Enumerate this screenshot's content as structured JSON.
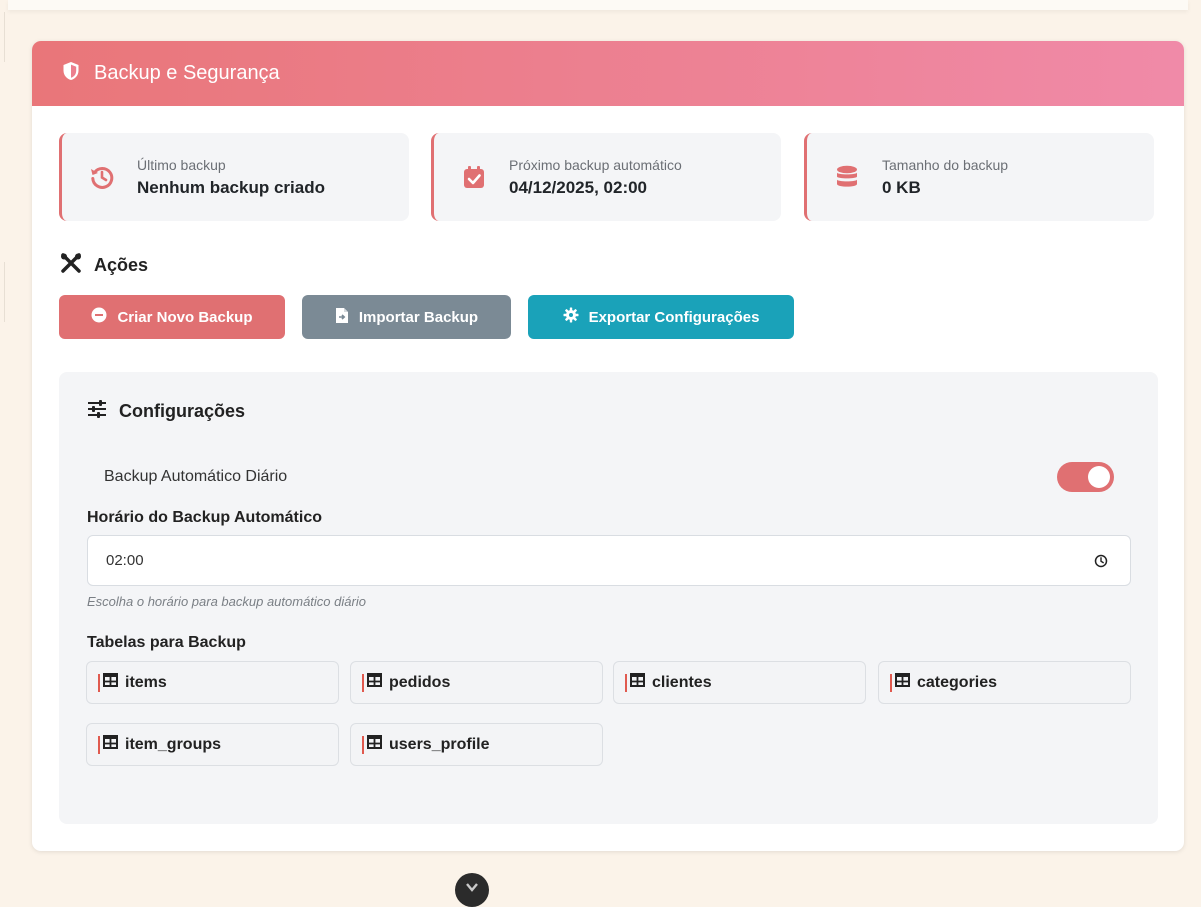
{
  "card": {
    "title": "Backup e Segurança",
    "accent_color": "#e07072"
  },
  "stats": [
    {
      "icon": "history-icon",
      "label": "Último backup",
      "value": "Nenhum backup criado"
    },
    {
      "icon": "calendar-check-icon",
      "label": "Próximo backup automático",
      "value": "04/12/2025, 02:00"
    },
    {
      "icon": "database-icon",
      "label": "Tamanho do backup",
      "value": "0 KB"
    }
  ],
  "actions": {
    "title": "Ações",
    "create_label": "Criar Novo Backup",
    "import_label": "Importar Backup",
    "export_label": "Exportar Configurações"
  },
  "config": {
    "title": "Configurações",
    "auto_backup_label": "Backup Automático Diário",
    "auto_backup_enabled": true,
    "time_label": "Horário do Backup Automático",
    "time_value": "02:00",
    "time_hint": "Escolha o horário para backup automático diário",
    "tables_label": "Tabelas para Backup",
    "tables": [
      "items",
      "pedidos",
      "clientes",
      "categories",
      "item_groups",
      "users_profile"
    ]
  },
  "colors": {
    "header_start": "#e97679",
    "header_end": "#f08aa8",
    "create_button": "#e07072",
    "import_button": "#7b8a95",
    "export_button": "#1aa2b9"
  }
}
